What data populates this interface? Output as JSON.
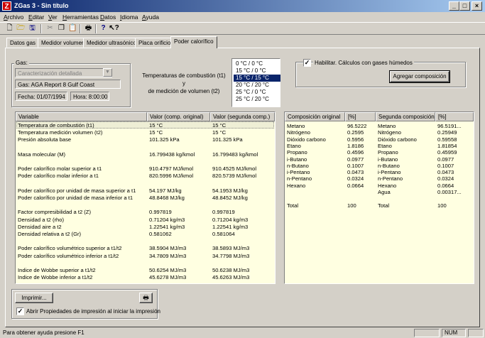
{
  "window": {
    "title": "ZGas 3 - Sin título"
  },
  "menu": [
    "Archivo",
    "Editar",
    "Ver",
    "Herramientas",
    "Datos",
    "Idioma",
    "Ayuda"
  ],
  "tabs": [
    "Datos gas",
    "Medidor volumen",
    "Medidor ultrasónico",
    "Placa orificio",
    "Poder calorífico"
  ],
  "gas_group": {
    "label": "Gas:",
    "method": "Caracterización detallada",
    "gas_name": "Gas: AGA Report 8 Gulf Coast",
    "date": "Fecha: 01/07/1994",
    "time": "Hora: 8:00:00"
  },
  "temperatures": {
    "label_line1": "Temperaturas de combustión (t1) y",
    "label_line2": "de medición de volumen (t2)",
    "options": [
      "0 °C / 0 °C",
      "15 °C / 0 °C",
      "15 °C / 15 °C",
      "20 °C / 20 °C",
      "25 °C / 0 °C",
      "25 °C / 20 °C"
    ],
    "selected_index": 2
  },
  "wet_gas": {
    "checkbox_label": "Habilitar. Cálculos con gases húmedos",
    "checked": true,
    "add_button": "Agregar composición"
  },
  "results": {
    "headers": [
      "Variable",
      "Valor (comp. original)",
      "Valor (segunda comp.)"
    ],
    "rows": [
      [
        "Temperatura de combustión (t1)",
        "15 °C",
        "15 °C"
      ],
      [
        "Temperatura medición volumen (t2)",
        "15 °C",
        "15 °C"
      ],
      [
        "Presión absoluta base",
        "101.325  kPa",
        "101.325  kPa"
      ],
      [
        "",
        "",
        ""
      ],
      [
        "Masa molecular (M)",
        "16.799438  kg/kmol",
        "16.799483  kg/kmol"
      ],
      [
        "",
        "",
        ""
      ],
      [
        "Poder calorífico molar superior a t1",
        "910.4797  MJ/kmol",
        "910.4525  MJ/kmol"
      ],
      [
        "Poder calorífico molar inferior a t1",
        "820.5996  MJ/kmol",
        "820.5739  MJ/kmol"
      ],
      [
        "",
        "",
        ""
      ],
      [
        "Poder calorífico por unidad de masa superior a t1",
        "54.197  MJ/kg",
        "54.1953  MJ/kg"
      ],
      [
        "Poder calorífico por unidad de masa inferior a t1",
        "48.8468  MJ/kg",
        "48.8452  MJ/kg"
      ],
      [
        "",
        "",
        ""
      ],
      [
        "Factor compresibilidad a t2 (Z)",
        "0.997819",
        "0.997819"
      ],
      [
        "Densidad a t2 (rho)",
        "0.71204  kg/m3",
        "0.71204  kg/m3"
      ],
      [
        "Densidad aire a t2",
        "1.22541  kg/m3",
        "1.22541  kg/m3"
      ],
      [
        "Densidad relativa a t2 (Gr)",
        "0.581062",
        "0.581064"
      ],
      [
        "",
        "",
        ""
      ],
      [
        "Poder calorífico volumétrico superior a t1/t2",
        "38.5904  MJ/m3",
        "38.5893  MJ/m3"
      ],
      [
        "Poder calorífico volumétrico inferior a t1/t2",
        "34.7809  MJ/m3",
        "34.7798  MJ/m3"
      ],
      [
        "",
        "",
        ""
      ],
      [
        "Indice de Wobbe superior a t1/t2",
        "50.6254  MJ/m3",
        "50.6238  MJ/m3"
      ],
      [
        "Indice de Wobbe inferior a t1/t2",
        "45.6278  MJ/m3",
        "45.6263  MJ/m3"
      ]
    ]
  },
  "composition": {
    "headers": [
      "Composición original",
      "[%]",
      "Segunda composición",
      "[%]"
    ],
    "rows": [
      [
        "Metano",
        "96.5222",
        "Metano",
        "96.5191..."
      ],
      [
        "Nitrógeno",
        "0.2595",
        "Nitrógeno",
        "0.25949"
      ],
      [
        "Dióxido carbono",
        "0.5956",
        "Dióxido carbono",
        "0.59558"
      ],
      [
        "Etano",
        "1.8186",
        "Etano",
        "1.81854"
      ],
      [
        "Propano",
        "0.4596",
        "Propano",
        "0.45959"
      ],
      [
        "i-Butano",
        "0.0977",
        "i-Butano",
        "0.0977"
      ],
      [
        "n-Butano",
        "0.1007",
        "n-Butano",
        "0.1007"
      ],
      [
        "i-Pentano",
        "0.0473",
        "i-Pentano",
        "0.0473"
      ],
      [
        "n-Pentano",
        "0.0324",
        "n-Pentano",
        "0.0324"
      ],
      [
        "Hexano",
        "0.0664",
        "Hexano",
        "0.0664"
      ],
      [
        "",
        "",
        "Agua",
        "0.00317..."
      ],
      [
        "",
        "",
        "",
        ""
      ],
      [
        "Total",
        "100",
        "Total",
        "100"
      ]
    ]
  },
  "print_group": {
    "print_button": "Imprimir...",
    "checkbox_label": "Abrir Propiedades de impresión al iniciar la impresión",
    "checked": true
  },
  "status": {
    "help_text": "Para obtener ayuda presione F1",
    "num": "NUM"
  }
}
